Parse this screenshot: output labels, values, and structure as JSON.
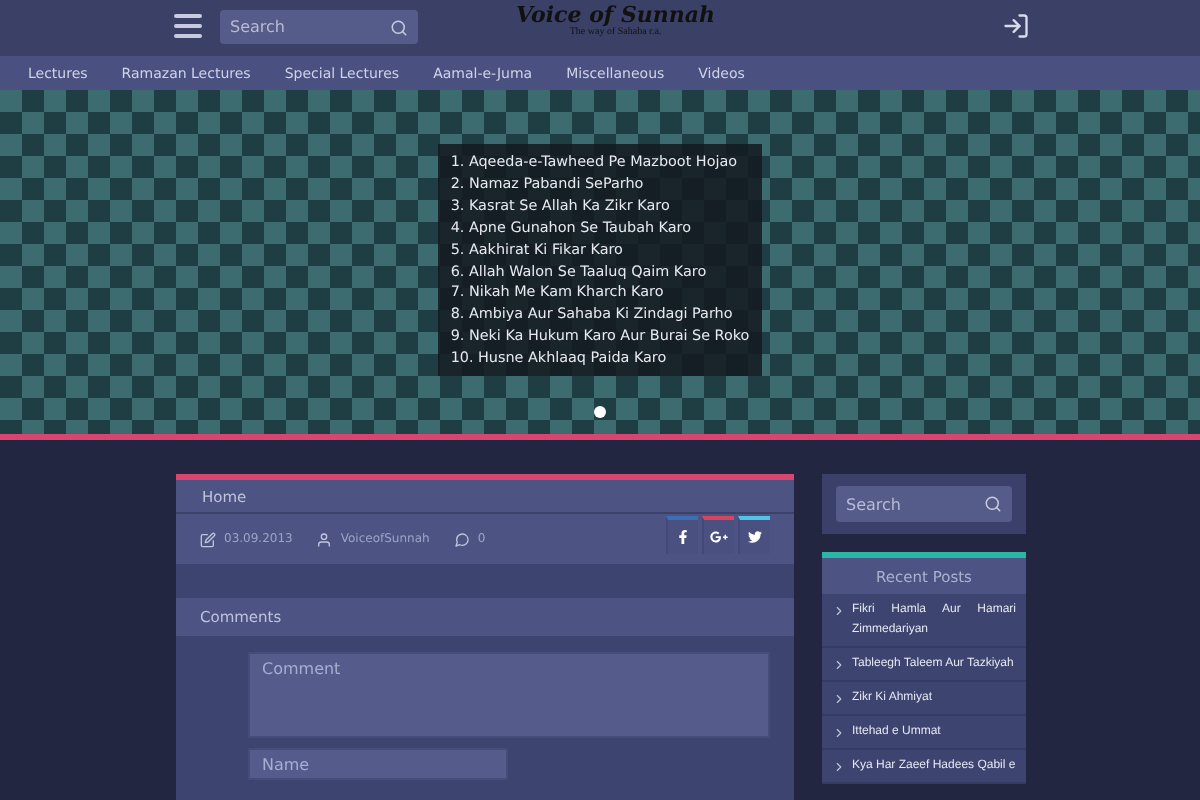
{
  "header": {
    "search": {
      "placeholder": "Search"
    },
    "logo": {
      "title": "Voice of Sunnah",
      "tagline": "The way of Sahaba r.a."
    }
  },
  "nav": [
    {
      "label": "Lectures"
    },
    {
      "label": "Ramazan Lectures"
    },
    {
      "label": "Special Lectures"
    },
    {
      "label": "Aamal-e-Juma"
    },
    {
      "label": "Miscellaneous"
    },
    {
      "label": "Videos"
    }
  ],
  "banner": {
    "items": [
      "1. Aqeeda-e-Tawheed Pe Mazboot Hojao",
      "2. Namaz Pabandi SeParho",
      "3. Kasrat Se Allah Ka Zikr Karo",
      "4. Apne Gunahon Se Taubah Karo",
      "5. Aakhirat Ki Fikar Karo",
      "6. Allah Walon Se Taaluq Qaim Karo",
      "7. Nikah Me Kam Kharch Karo",
      "8. Ambiya Aur Sahaba Ki Zindagi Parho",
      "9. Neki Ka Hukum Karo Aur Burai Se Roko",
      "10. Husne Akhlaaq Paida Karo"
    ],
    "dots": [
      {
        "selected": true
      }
    ]
  },
  "post": {
    "title": "Home",
    "date": "03.09.2013",
    "author": "VoiceofSunnah",
    "comments": "0",
    "share": [
      {
        "kind": "facebook",
        "color": "#3b6fb6"
      },
      {
        "kind": "googleplus",
        "color": "#d9455a"
      },
      {
        "kind": "twitter",
        "color": "#4fc3e8"
      }
    ]
  },
  "comments": {
    "title": "Comments",
    "fields": [
      {
        "placeholder": "Comment",
        "kind": "textarea"
      },
      {
        "placeholder": "Name",
        "kind": "input"
      }
    ]
  },
  "sidebar": {
    "search": {
      "placeholder": "Search"
    },
    "recent": {
      "title": "Recent Posts",
      "items": [
        "Fikri Hamla Aur Hamari Zimmedariyan",
        "Tableegh Taleem Aur Tazkiyah",
        "Zikr Ki Ahmiyat",
        "Ittehad e Ummat",
        "Kya Har Zaeef Hadees Qabil e"
      ]
    }
  }
}
